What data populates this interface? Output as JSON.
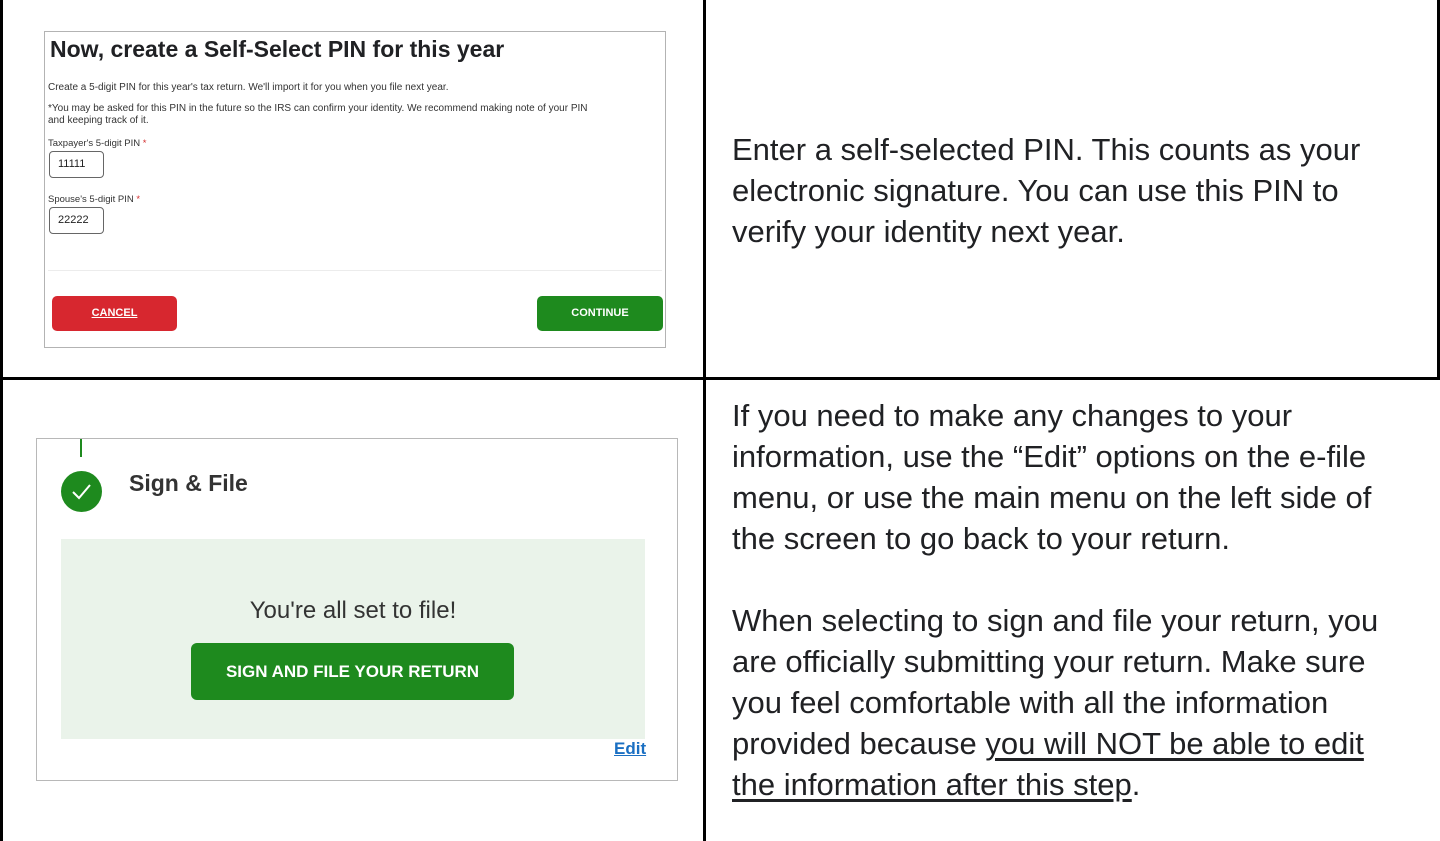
{
  "row1": {
    "screenshot": {
      "title": "Now, create a Self-Select PIN for this year",
      "description_line1": "Create a 5-digit PIN for this year's tax return. We'll import it for you when you file next year.",
      "description_line2": "*You may be asked for this PIN in the future so the IRS can confirm your identity. We recommend making note of your PIN",
      "description_line3": "and keeping track of it.",
      "taxpayer_label": "Taxpayer's 5-digit PIN",
      "taxpayer_value": "11111",
      "spouse_label": "Spouse's 5-digit PIN",
      "spouse_value": "22222",
      "required_mark": "*",
      "cancel_label": "CANCEL",
      "continue_label": "CONTINUE"
    },
    "text_line1": "Enter a self-selected PIN. This counts as your",
    "text_line2": "electronic signature. You can use this PIN to",
    "text_line3": "verify your identity next year."
  },
  "row2": {
    "screenshot": {
      "section_title": "Sign & File",
      "ready_text": "You're all set to file!",
      "sign_button_label": "SIGN AND FILE YOUR RETURN",
      "edit_label": "Edit"
    },
    "para1_line1": "If you need to make any changes to your",
    "para1_line2": "information, use the “Edit” options on the e-file",
    "para1_line3": "menu, or use the main menu on the left side of",
    "para1_line4": "the screen to go back to your return.",
    "para2_line1": "When selecting to sign and file your return, you",
    "para2_line2": "are officially submitting your return. Make sure",
    "para2_line3": "you feel comfortable with all the information",
    "para2_line4_prefix": "provided because ",
    "para2_line4_underlined": "you will NOT be able to edit",
    "para2_line5_underlined": "the information after this step",
    "para2_line5_suffix": "."
  },
  "colors": {
    "green": "#1e8a1e",
    "red": "#d7272f",
    "panel_green": "#eaf3ea",
    "link_blue": "#1a6fc2"
  }
}
